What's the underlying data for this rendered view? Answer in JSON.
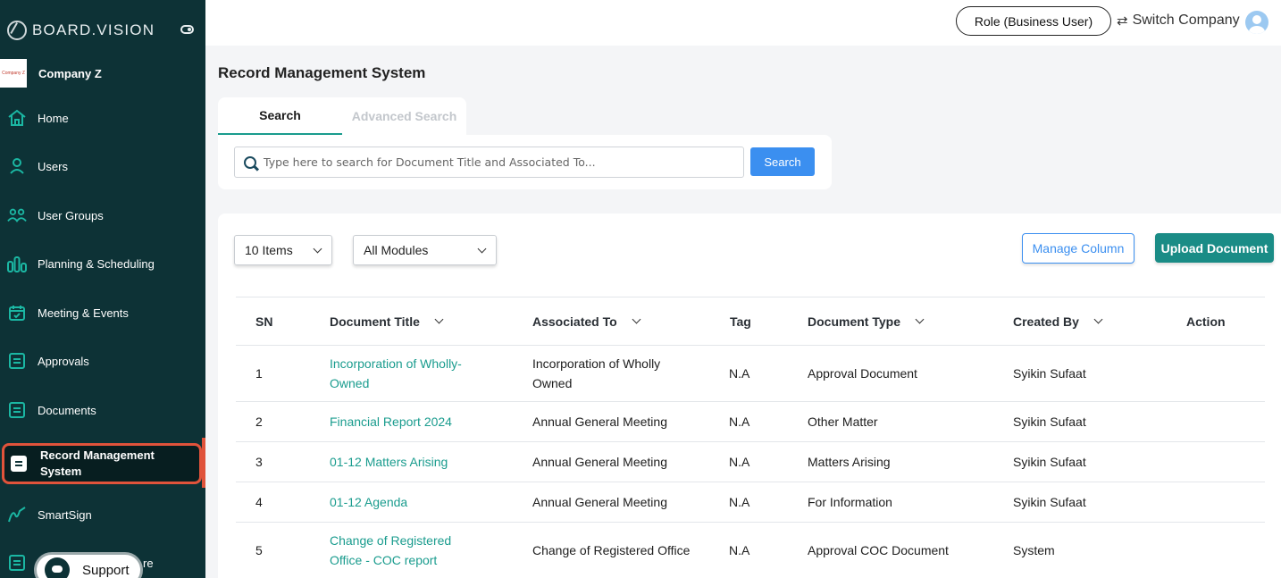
{
  "brand": {
    "name": "BOARD.VISION"
  },
  "company": {
    "name": "Company Z",
    "logo_text": "Company Z"
  },
  "sidebar": {
    "items": [
      {
        "label": "Home",
        "icon": "home-icon"
      },
      {
        "label": "Users",
        "icon": "user-icon"
      },
      {
        "label": "User Groups",
        "icon": "user-group-icon"
      },
      {
        "label": "Planning & Scheduling",
        "icon": "planning-icon"
      },
      {
        "label": "Meeting & Events",
        "icon": "calendar-icon"
      },
      {
        "label": "Approvals",
        "icon": "approvals-icon"
      },
      {
        "label": "Documents",
        "icon": "documents-icon"
      },
      {
        "label": "Record Management System",
        "icon": "record-icon",
        "active": true
      },
      {
        "label": "SmartSign",
        "icon": "signature-icon"
      }
    ],
    "partial_label_suffix": "re",
    "support_label": "Support"
  },
  "topbar": {
    "role_label": "Role (Business User)",
    "switch_label": "Switch Company"
  },
  "page": {
    "title": "Record Management System"
  },
  "search": {
    "tabs": [
      "Search",
      "Advanced Search"
    ],
    "placeholder": "Type here to search for Document Title and Associated To...",
    "button_label": "Search"
  },
  "controls": {
    "items_per_page": "10 Items",
    "module_filter": "All Modules",
    "manage_column_label": "Manage Column",
    "upload_label": "Upload Document"
  },
  "table": {
    "headers": [
      "SN",
      "Document Title",
      "Associated To",
      "Tag",
      "Document Type",
      "Created By",
      "Action"
    ],
    "rows": [
      {
        "sn": "1",
        "title_l1": "Incorporation of Wholly-",
        "title_l2": "Owned",
        "assoc_l1": "Incorporation of Wholly",
        "assoc_l2": "Owned",
        "tag": "N.A",
        "type": "Approval Document",
        "created_by": "Syikin Sufaat"
      },
      {
        "sn": "2",
        "title_l1": "Financial Report 2024",
        "title_l2": "",
        "assoc_l1": "Annual General Meeting",
        "assoc_l2": "",
        "tag": "N.A",
        "type": "Other Matter",
        "created_by": "Syikin Sufaat"
      },
      {
        "sn": "3",
        "title_l1": "01-12 Matters Arising",
        "title_l2": "",
        "assoc_l1": "Annual General Meeting",
        "assoc_l2": "",
        "tag": "N.A",
        "type": "Matters Arising",
        "created_by": "Syikin Sufaat"
      },
      {
        "sn": "4",
        "title_l1": "01-12 Agenda",
        "title_l2": "",
        "assoc_l1": "Annual General Meeting",
        "assoc_l2": "",
        "tag": "N.A",
        "type": "For Information",
        "created_by": "Syikin Sufaat"
      },
      {
        "sn": "5",
        "title_l1": "Change of Registered",
        "title_l2": "Office - COC report",
        "assoc_l1": "Change of Registered Office",
        "assoc_l2": "",
        "tag": "N.A",
        "type": "Approval COC Document",
        "created_by": "System"
      }
    ]
  },
  "colors": {
    "sidebar_bg": "#0d3236",
    "accent_teal": "#1a9c8e",
    "primary_blue": "#3b8ff0",
    "active_border": "#e0533b"
  }
}
